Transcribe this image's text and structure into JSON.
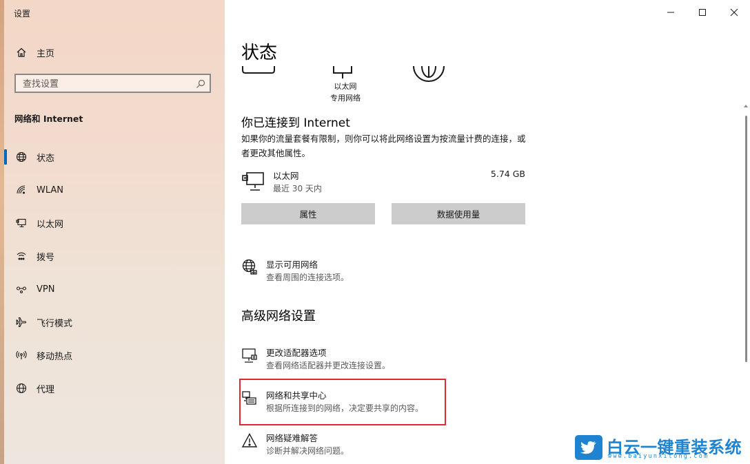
{
  "window": {
    "title": "设置",
    "controls": {
      "minimize": "minimize",
      "maximize": "maximize",
      "close": "close"
    }
  },
  "sidebar": {
    "home_label": "主页",
    "search_placeholder": "查找设置",
    "section_title": "网络和 Internet",
    "items": [
      {
        "label": "状态",
        "icon": "globe-icon",
        "active": true
      },
      {
        "label": "WLAN",
        "icon": "wifi-icon",
        "active": false
      },
      {
        "label": "以太网",
        "icon": "ethernet-icon",
        "active": false
      },
      {
        "label": "拨号",
        "icon": "dialup-icon",
        "active": false
      },
      {
        "label": "VPN",
        "icon": "vpn-icon",
        "active": false
      },
      {
        "label": "飞行模式",
        "icon": "airplane-icon",
        "active": false
      },
      {
        "label": "移动热点",
        "icon": "hotspot-icon",
        "active": false
      },
      {
        "label": "代理",
        "icon": "globe-icon",
        "active": false
      }
    ]
  },
  "main": {
    "page_title": "状态",
    "diagram": {
      "ethernet_label": "以太网",
      "network_type": "专用网络"
    },
    "connected_title": "你已连接到 Internet",
    "connected_desc": "如果你的流量套餐有限制，则你可以将此网络设置为按流量计费的连接，或者更改其他属性。",
    "adapter": {
      "name": "以太网",
      "period": "最近 30 天内",
      "usage": "5.74 GB"
    },
    "buttons": {
      "properties": "属性",
      "data_usage": "数据使用量"
    },
    "show_networks": {
      "title": "显示可用网络",
      "subtitle": "查看周围的连接选项。"
    },
    "advanced_title": "高级网络设置",
    "advanced_items": [
      {
        "title": "更改适配器选项",
        "subtitle": "查看网络适配器并更改连接设置。",
        "icon": "adapter-icon"
      },
      {
        "title": "网络和共享中心",
        "subtitle": "根据所连接到的网络，决定要共享的内容。",
        "icon": "sharing-center-icon"
      },
      {
        "title": "网络疑难解答",
        "subtitle": "诊断并解决网络问题。",
        "icon": "warning-icon"
      }
    ]
  },
  "watermark": {
    "text": "白云一键重装系统",
    "url": "www.baiyunxitong.com"
  },
  "colors": {
    "accent": "#0067c0",
    "highlight": "#e0282e",
    "button_bg": "#cccccc",
    "watermark": "#1e84d2"
  }
}
